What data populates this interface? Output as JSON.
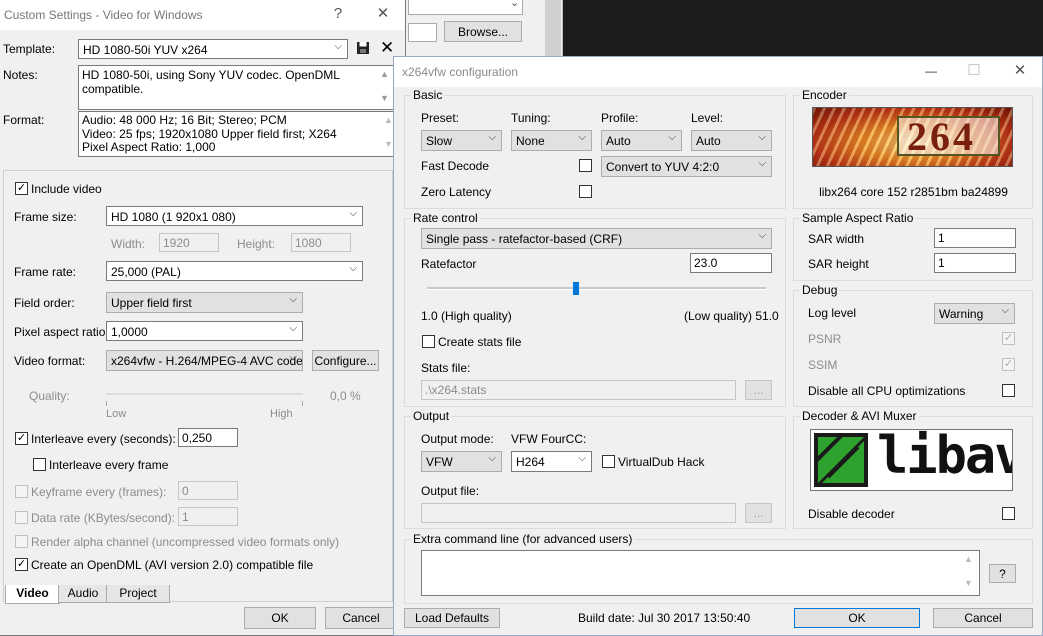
{
  "background_window": {
    "browse_label": "Browse...",
    "scroll_down_arrow": "⌄"
  },
  "video_settings": {
    "title": "Custom Settings - Video for Windows",
    "help_glyph": "?",
    "close_glyph": "✕",
    "template_label": "Template:",
    "template_value": "HD 1080-50i YUV x264",
    "notes_label": "Notes:",
    "notes_value": "HD 1080-50i, using Sony YUV codec. OpenDML compatible.",
    "format_label": "Format:",
    "format_line1": "Audio: 48 000 Hz; 16 Bit; Stereo; PCM",
    "format_line2": "Video: 25 fps; 1920x1080 Upper field first; X264",
    "format_line3": "Pixel Aspect Ratio: 1,000",
    "include_video_label": "Include video",
    "frame_size_label": "Frame size:",
    "frame_size_value": "HD 1080 (1 920x1 080)",
    "width_label": "Width:",
    "width_value": "1920",
    "height_label": "Height:",
    "height_value": "1080",
    "frame_rate_label": "Frame rate:",
    "frame_rate_value": "25,000 (PAL)",
    "field_order_label": "Field order:",
    "field_order_value": "Upper field first",
    "pixel_aspect_label": "Pixel aspect ratio:",
    "pixel_aspect_value": "1,0000",
    "video_format_label": "Video format:",
    "video_format_value": "x264vfw - H.264/MPEG-4 AVC codec",
    "configure_label": "Configure...",
    "quality_label": "Quality:",
    "quality_value": "0,0 %",
    "quality_low": "Low",
    "quality_high": "High",
    "interleave_label": "Interleave every (seconds):",
    "interleave_value": "0,250",
    "interleave_frame_label": "Interleave every frame",
    "keyframe_label": "Keyframe every (frames):",
    "keyframe_value": "0",
    "data_rate_label": "Data rate (KBytes/second):",
    "data_rate_value": "1",
    "render_alpha_label": "Render alpha channel (uncompressed video formats only)",
    "opendml_label": "Create an OpenDML (AVI version 2.0) compatible file",
    "tabs": [
      "Video",
      "Audio",
      "Project"
    ],
    "ok_label": "OK",
    "cancel_label": "Cancel"
  },
  "x264": {
    "title": "x264vfw configuration",
    "basic_title": "Basic",
    "preset_label": "Preset:",
    "preset_value": "Slow",
    "tuning_label": "Tuning:",
    "tuning_value": "None",
    "profile_label": "Profile:",
    "profile_value": "Auto",
    "level_label": "Level:",
    "level_value": "Auto",
    "fast_decode_label": "Fast Decode",
    "zero_latency_label": "Zero Latency",
    "convert_value": "Convert to YUV 4:2:0",
    "encoder_title": "Encoder",
    "encoder_logo_text": "264",
    "encoder_version": "libx264 core 152 r2851bm ba24899",
    "rate_title": "Rate control",
    "rate_mode_value": "Single pass - ratefactor-based (CRF)",
    "ratefactor_label": "Ratefactor",
    "ratefactor_value": "23.0",
    "slider_fraction": 0.44,
    "high_quality_label": "1.0 (High quality)",
    "low_quality_label": "(Low quality) 51.0",
    "create_stats_label": "Create stats file",
    "stats_file_label": "Stats file:",
    "stats_file_value": ".\\x264.stats",
    "browse_small_label": "...",
    "sar_title": "Sample Aspect Ratio",
    "sar_width_label": "SAR width",
    "sar_width_value": "1",
    "sar_height_label": "SAR height",
    "sar_height_value": "1",
    "debug_title": "Debug",
    "log_level_label": "Log level",
    "log_level_value": "Warning",
    "psnr_label": "PSNR",
    "ssim_label": "SSIM",
    "disable_cpu_label": "Disable all CPU optimizations",
    "output_title": "Output",
    "output_mode_label": "Output mode:",
    "output_mode_value": "VFW",
    "fourcc_label": "VFW FourCC:",
    "fourcc_value": "H264",
    "vdub_hack_label": "VirtualDub Hack",
    "output_file_label": "Output file:",
    "decoder_title": "Decoder & AVI Muxer",
    "decoder_logo_text": "libav",
    "disable_decoder_label": "Disable decoder",
    "extra_title": "Extra command line (for advanced users)",
    "help_button_label": "?",
    "load_defaults_label": "Load Defaults",
    "build_date": "Build date: Jul 30 2017 13:50:40",
    "ok_label": "OK",
    "cancel_label": "Cancel",
    "min_glyph": "—",
    "max_glyph": "☐",
    "close_glyph": "✕"
  }
}
